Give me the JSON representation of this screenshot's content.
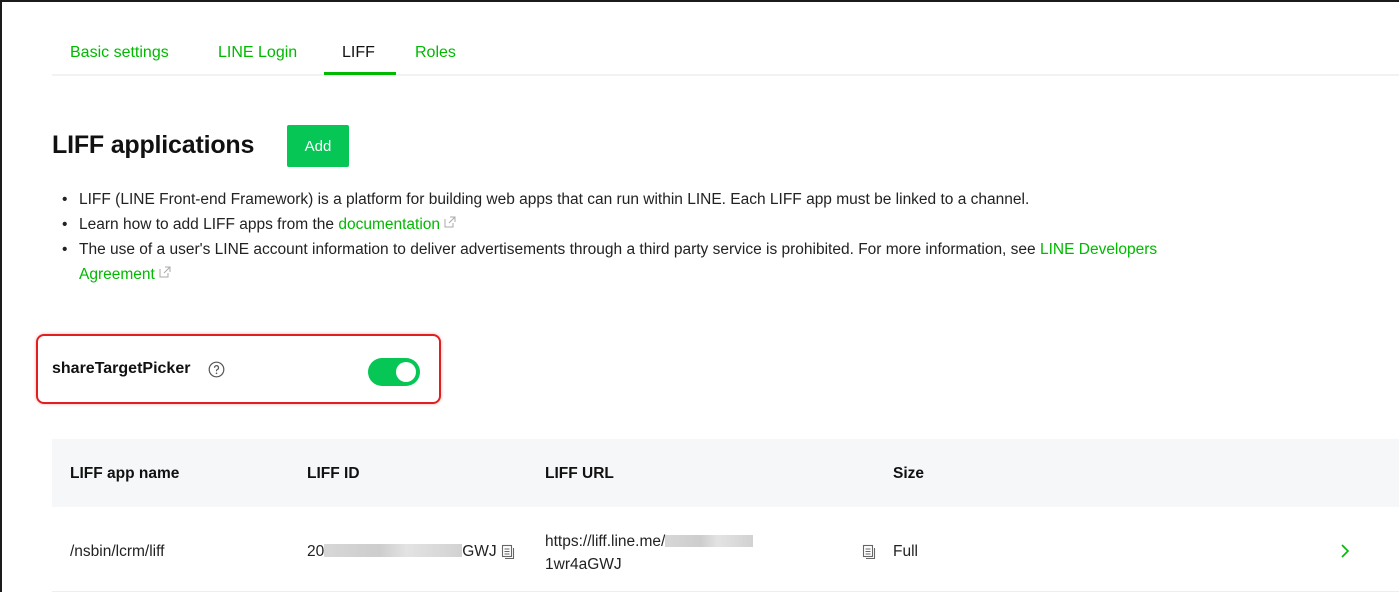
{
  "tabs": [
    {
      "label": "Basic settings"
    },
    {
      "label": "LINE Login"
    },
    {
      "label": "LIFF"
    },
    {
      "label": "Roles"
    }
  ],
  "active_tab": "LIFF",
  "page_title": "LIFF applications",
  "add_label": "Add",
  "bullets": {
    "b1": "LIFF (LINE Front-end Framework) is a platform for building web apps that can run within LINE. Each LIFF app must be linked to a channel.",
    "b2_text": "Learn how to add LIFF apps from the ",
    "b2_link": "documentation",
    "b3_text": "The use of a user's LINE account information to deliver advertisements through a third party service is prohibited. For more information, see ",
    "b3_link_1": "LINE Developers",
    "b3_link_2": "Agreement"
  },
  "share_target_picker": {
    "label": "shareTargetPicker",
    "enabled": true
  },
  "table": {
    "headers": {
      "name": "LIFF app name",
      "id": "LIFF ID",
      "url": "LIFF URL",
      "size": "Size"
    },
    "rows": [
      {
        "name": "/nsbin/lcrm/liff",
        "id_prefix": "20",
        "id_suffix": "GWJ",
        "url_line1": "https://liff.line.me/",
        "url_line2": "1wr4aGWJ",
        "size": "Full"
      }
    ]
  },
  "colors": {
    "accent": "#00b900",
    "button": "#06c755",
    "highlight": "#e02020"
  }
}
